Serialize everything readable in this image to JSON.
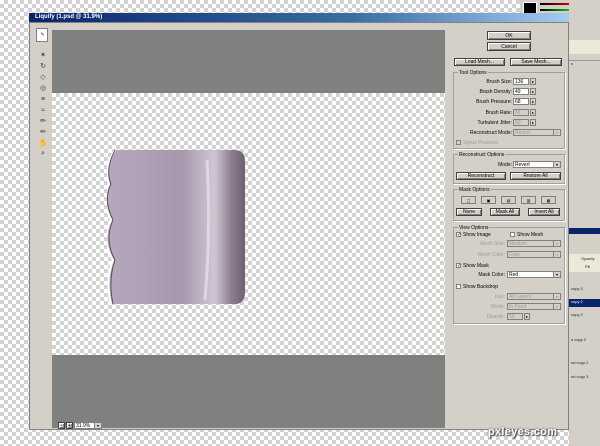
{
  "window": {
    "title": "Liquify (1.psd @ 31.9%)"
  },
  "buttons": {
    "ok": "OK",
    "cancel": "Cancel",
    "load_mesh": "Load Mesh...",
    "save_mesh": "Save Mesh..."
  },
  "tool_options": {
    "title": "Tool Options",
    "brush_size": {
      "label": "Brush Size:",
      "value": "136"
    },
    "brush_density": {
      "label": "Brush Density:",
      "value": "49"
    },
    "brush_pressure": {
      "label": "Brush Pressure:",
      "value": "68"
    },
    "brush_rate": {
      "label": "Brush Rate:",
      "value": "80"
    },
    "turbulent_jitter": {
      "label": "Turbulent Jitter:",
      "value": "50"
    },
    "reconstruct_mode": {
      "label": "Reconstruct Mode:",
      "value": "Revert"
    },
    "stylus_pressure": "Stylus Pressure"
  },
  "reconstruct_options": {
    "title": "Reconstruct Options",
    "mode_label": "Mode:",
    "mode_value": "Revert",
    "reconstruct": "Reconstruct",
    "restore_all": "Restore All"
  },
  "mask_options": {
    "title": "Mask Options",
    "none": "None",
    "mask_all": "Mask All",
    "invert_all": "Invert All"
  },
  "view_options": {
    "title": "View Options",
    "show_image": "Show Image",
    "show_mesh": "Show Mesh",
    "mesh_size_label": "Mesh Size:",
    "mesh_size_value": "Medium",
    "mesh_color_label": "Mesh Color:",
    "mesh_color_value": "Gray",
    "show_mask": "Show Mask",
    "mask_color_label": "Mask Color:",
    "mask_color_value": "Red",
    "show_backdrop": "Show Backdrop",
    "use_label": "Use:",
    "use_value": "All Layers",
    "backdrop_mode_label": "Mode:",
    "backdrop_mode_value": "In Front",
    "opacity_label": "Opacity:",
    "opacity_value": "50"
  },
  "zoom": {
    "value": "31.9%",
    "minus": "-",
    "plus": "+"
  },
  "background_panel": {
    "items": [
      "11",
      "13",
      "x",
      "Opacity",
      "Fill",
      "copy 3",
      "copy 2",
      "copy 2",
      "d copy 2",
      "nd copy 2",
      "nd copy 3"
    ]
  },
  "watermark": "pxleyes.com",
  "colors": {
    "dialog": "#d4d0c8",
    "preview": "#808080",
    "titlebar": "#0a246a",
    "liquid": "#a897ab"
  }
}
